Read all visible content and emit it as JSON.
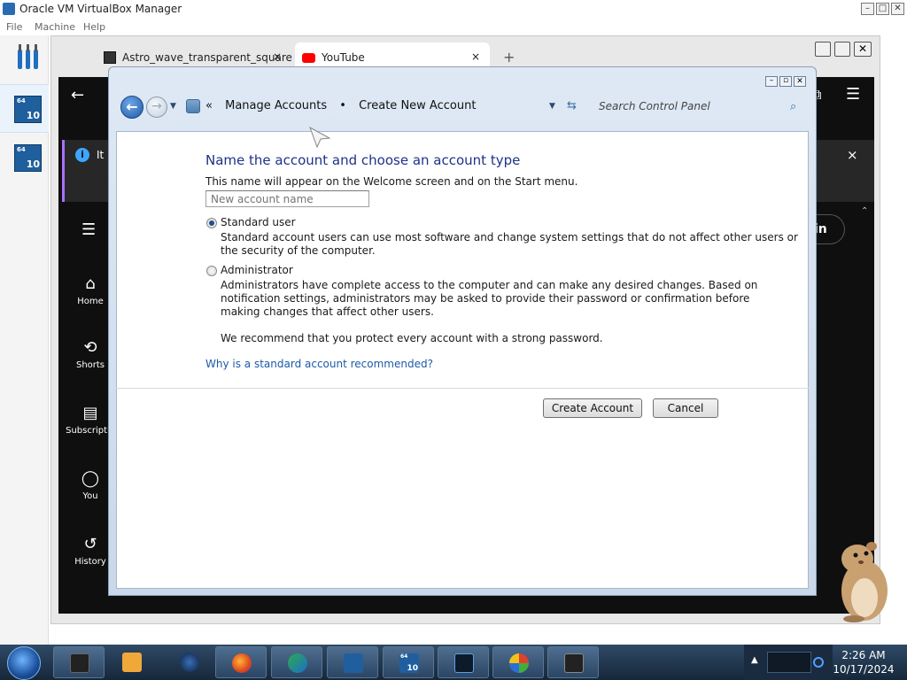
{
  "vbox": {
    "title": "Oracle VM VirtualBox Manager",
    "menu": [
      "File",
      "Machine",
      "Help"
    ],
    "vm_badge_bits": "64",
    "vm_badge_version": "10"
  },
  "browser": {
    "tabs": [
      {
        "label": "Astro_wave_transparent_square",
        "close": "×"
      },
      {
        "label": "YouTube",
        "close": "×"
      }
    ],
    "new_tab": "+",
    "info_text": "It l",
    "info_close": "×",
    "sign_in": "in",
    "yt_nav": [
      {
        "icon": "⌂",
        "label": "Home"
      },
      {
        "icon": "⟲",
        "label": "Shorts"
      },
      {
        "icon": "▤",
        "label": "Subscriptio"
      },
      {
        "icon": "◯",
        "label": "You"
      },
      {
        "icon": "↺",
        "label": "History"
      }
    ]
  },
  "control_panel": {
    "breadcrumb_sep": "«",
    "breadcrumb": [
      "Manage Accounts",
      "Create New Account"
    ],
    "breadcrumb_dot": "•",
    "search_placeholder": "Search Control Panel",
    "heading": "Name the account and choose an account type",
    "intro": "This name will appear on the Welcome screen and on the Start menu.",
    "name_placeholder": "New account name",
    "standard": {
      "label": "Standard user",
      "desc1": "Standard account users can use most software and change system settings that do not affect other users or",
      "desc2": "the security of the computer.",
      "selected": true
    },
    "admin": {
      "label": "Administrator",
      "desc1": "Administrators have complete access to the computer and can make any desired changes. Based on",
      "desc2": "notification settings, administrators may be asked to provide their password or confirmation before",
      "desc3": "making changes that affect other users.",
      "selected": false
    },
    "recommend": "We recommend that you protect every account with a strong password.",
    "why_link": "Why is a standard account recommended?",
    "create_button": "Create Account",
    "cancel_button": "Cancel"
  },
  "taskbar": {
    "time": "2:26 AM",
    "date": "10/17/2024",
    "vm_badge_bits": "64",
    "vm_badge_version": "10"
  },
  "colors": {
    "heading": "#1e3287",
    "link": "#1c5aa8",
    "taskbar": "#16273a"
  }
}
